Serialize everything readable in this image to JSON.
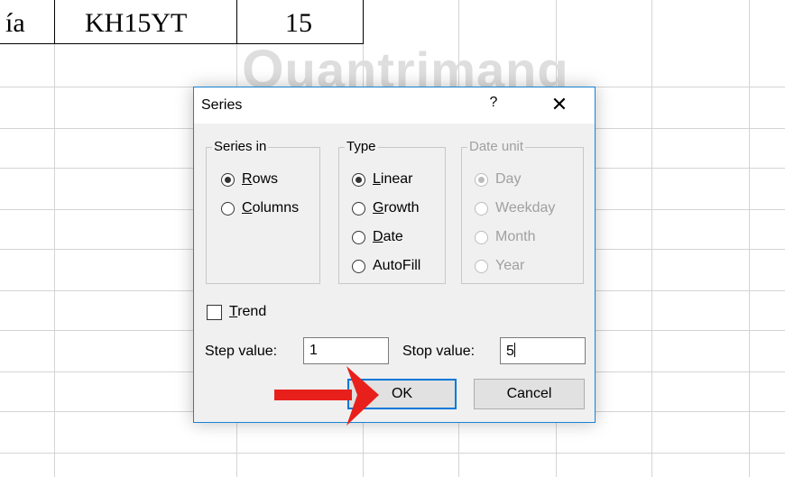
{
  "spreadsheet": {
    "cells": {
      "a1_partial": "ía",
      "b1": "KH15YT",
      "c1": "15"
    },
    "watermark": "uantrimang"
  },
  "dialog": {
    "title": "Series",
    "help_label": "?",
    "close_label": "✕",
    "series_in": {
      "legend": "Series in",
      "options": [
        {
          "label": "Rows",
          "selected": true
        },
        {
          "label": "Columns",
          "selected": false
        }
      ]
    },
    "type": {
      "legend": "Type",
      "options": [
        {
          "label": "Linear",
          "selected": true
        },
        {
          "label": "Growth",
          "selected": false
        },
        {
          "label": "Date",
          "selected": false
        },
        {
          "label": "AutoFill",
          "selected": false
        }
      ]
    },
    "date_unit": {
      "legend": "Date unit",
      "disabled": true,
      "options": [
        {
          "label": "Day",
          "selected": true
        },
        {
          "label": "Weekday",
          "selected": false
        },
        {
          "label": "Month",
          "selected": false
        },
        {
          "label": "Year",
          "selected": false
        }
      ]
    },
    "trend": {
      "label": "Trend",
      "checked": false
    },
    "step_value": {
      "label": "Step value:",
      "value": "1"
    },
    "stop_value": {
      "label": "Stop value:",
      "value": "5"
    },
    "ok_label": "OK",
    "cancel_label": "Cancel"
  },
  "colors": {
    "accent": "#0078d7",
    "arrow": "#e8201c",
    "disabled": "#a0a0a0"
  }
}
